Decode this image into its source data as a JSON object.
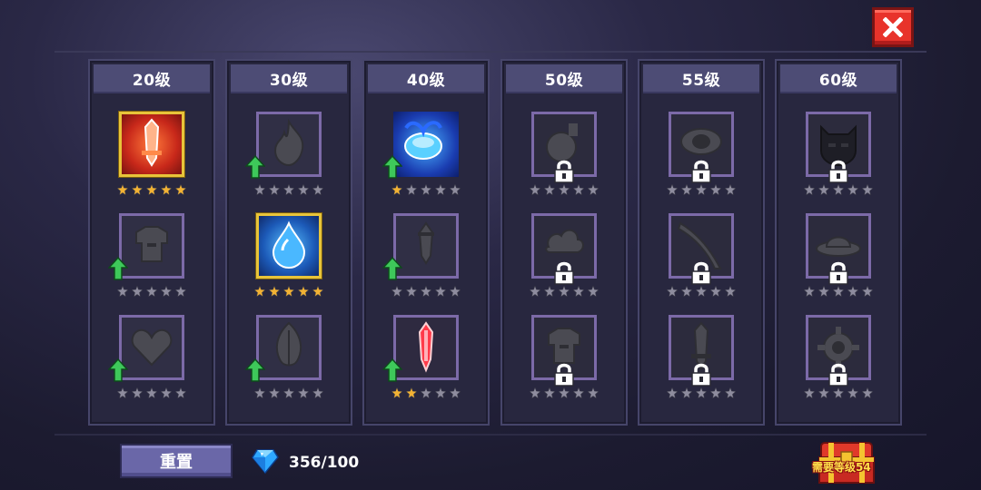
{
  "close_button": {
    "icon": "close-icon"
  },
  "columns": [
    {
      "level": "20级",
      "slots": [
        {
          "icon": "sword-icon",
          "state": "gold",
          "theme": "fire",
          "stars_filled": 5,
          "upgrade": false,
          "locked": false
        },
        {
          "icon": "armor-icon",
          "state": "normal",
          "stars_filled": 0,
          "upgrade": true,
          "locked": false
        },
        {
          "icon": "heart-icon",
          "state": "normal",
          "stars_filled": 0,
          "upgrade": true,
          "locked": false
        }
      ]
    },
    {
      "level": "30级",
      "slots": [
        {
          "icon": "flame-icon",
          "state": "normal",
          "stars_filled": 0,
          "upgrade": true,
          "locked": false
        },
        {
          "icon": "water-drop-icon",
          "state": "gold",
          "theme": "water",
          "stars_filled": 5,
          "upgrade": false,
          "locked": false
        },
        {
          "icon": "leaf-icon",
          "state": "normal",
          "stars_filled": 0,
          "upgrade": true,
          "locked": false
        }
      ]
    },
    {
      "level": "40级",
      "slots": [
        {
          "icon": "slime-icon",
          "state": "blue",
          "stars_filled": 1,
          "upgrade": true,
          "locked": false
        },
        {
          "icon": "dagger-icon",
          "state": "normal",
          "stars_filled": 0,
          "upgrade": true,
          "locked": false
        },
        {
          "icon": "red-crystal-icon",
          "state": "red",
          "stars_filled": 2,
          "upgrade": true,
          "locked": false
        }
      ]
    },
    {
      "level": "50级",
      "slots": [
        {
          "icon": "bomb-icon",
          "state": "locked",
          "stars_filled": 0,
          "upgrade": false,
          "locked": true
        },
        {
          "icon": "cloud-icon",
          "state": "locked",
          "stars_filled": 0,
          "upgrade": false,
          "locked": true
        },
        {
          "icon": "armor-icon",
          "state": "locked",
          "stars_filled": 0,
          "upgrade": false,
          "locked": true
        }
      ]
    },
    {
      "level": "55级",
      "slots": [
        {
          "icon": "eye-icon",
          "state": "locked",
          "stars_filled": 0,
          "upgrade": false,
          "locked": true
        },
        {
          "icon": "blade-icon",
          "state": "locked",
          "stars_filled": 0,
          "upgrade": false,
          "locked": true
        },
        {
          "icon": "sword-icon",
          "state": "locked",
          "stars_filled": 0,
          "upgrade": false,
          "locked": true
        }
      ]
    },
    {
      "level": "60级",
      "slots": [
        {
          "icon": "demon-icon",
          "state": "locked",
          "stars_filled": 0,
          "upgrade": false,
          "locked": true
        },
        {
          "icon": "ufo-icon",
          "state": "locked",
          "stars_filled": 0,
          "upgrade": false,
          "locked": true
        },
        {
          "icon": "gear-icon",
          "state": "locked",
          "stars_filled": 0,
          "upgrade": false,
          "locked": true
        }
      ]
    }
  ],
  "stars_total": 5,
  "reset_button": {
    "label": "重置"
  },
  "gems": {
    "icon": "gem-icon",
    "count": "356/100"
  },
  "chest": {
    "icon": "chest-icon",
    "label": "需要等级54"
  },
  "colors": {
    "star_filled": "#f2b234",
    "star_empty": "#8e8c9e",
    "upgrade_arrow": "#3ec85a",
    "gold_frame": "#e8c43a",
    "lock": "#ffffff"
  }
}
